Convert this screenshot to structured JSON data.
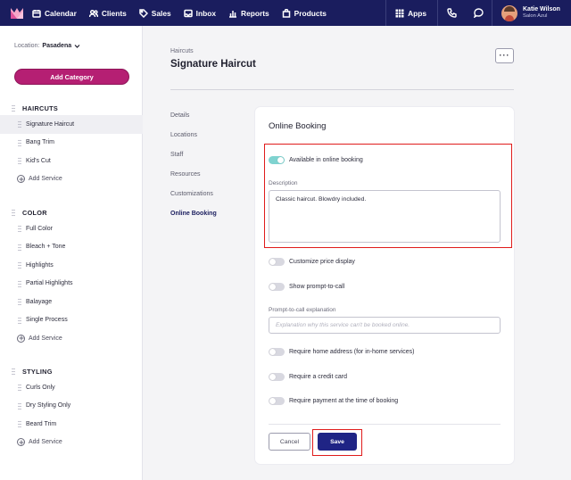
{
  "topbar": {
    "nav": [
      {
        "label": "Calendar",
        "icon": "calendar-icon"
      },
      {
        "label": "Clients",
        "icon": "users-icon"
      },
      {
        "label": "Sales",
        "icon": "tag-icon"
      },
      {
        "label": "Inbox",
        "icon": "inbox-icon"
      },
      {
        "label": "Reports",
        "icon": "bar-chart-icon"
      },
      {
        "label": "Products",
        "icon": "bag-icon"
      }
    ],
    "apps_label": "Apps",
    "user": {
      "name": "Katie Wilson",
      "business": "Salon Azul"
    }
  },
  "sidebar": {
    "location_label": "Location:",
    "location_value": "Pasadena",
    "add_category_label": "Add Category",
    "sections": [
      {
        "title": "HAIRCUTS",
        "items": [
          "Signature Haircut",
          "Bang Trim",
          "Kid's Cut"
        ],
        "add_label": "Add Service"
      },
      {
        "title": "COLOR",
        "items": [
          "Full Color",
          "Bleach + Tone",
          "Highlights",
          "Partial Highlights",
          "Balayage",
          "Single Process"
        ],
        "add_label": "Add Service"
      },
      {
        "title": "STYLING",
        "items": [
          "Curls Only",
          "Dry Styling Only",
          "Beard Trim"
        ],
        "add_label": "Add Service"
      }
    ]
  },
  "main": {
    "breadcrumb": "Haircuts",
    "title": "Signature Haircut",
    "more_label": "···",
    "subnav": [
      "Details",
      "Locations",
      "Staff",
      "Resources",
      "Customizations",
      "Online Booking"
    ],
    "card": {
      "title": "Online Booking",
      "available_label": "Available in online booking",
      "description_label": "Description",
      "description_value": "Classic haircut. Blowdry included.",
      "customize_price_label": "Customize price display",
      "show_prompt_label": "Show prompt-to-call",
      "prompt_expl_label": "Prompt-to-call explanation",
      "prompt_expl_placeholder": "Explanation why this service can't be booked online.",
      "require_home_label": "Require home address (for in-home services)",
      "require_card_label": "Require a credit card",
      "require_payment_label": "Require payment at the time of booking",
      "cancel_label": "Cancel",
      "save_label": "Save"
    }
  },
  "colors": {
    "topbar": "#1a1d5e",
    "accent": "#b51f73",
    "primary_button": "#1f2485",
    "toggle_on": "#7fd3d0",
    "highlight": "#e01b1b"
  }
}
